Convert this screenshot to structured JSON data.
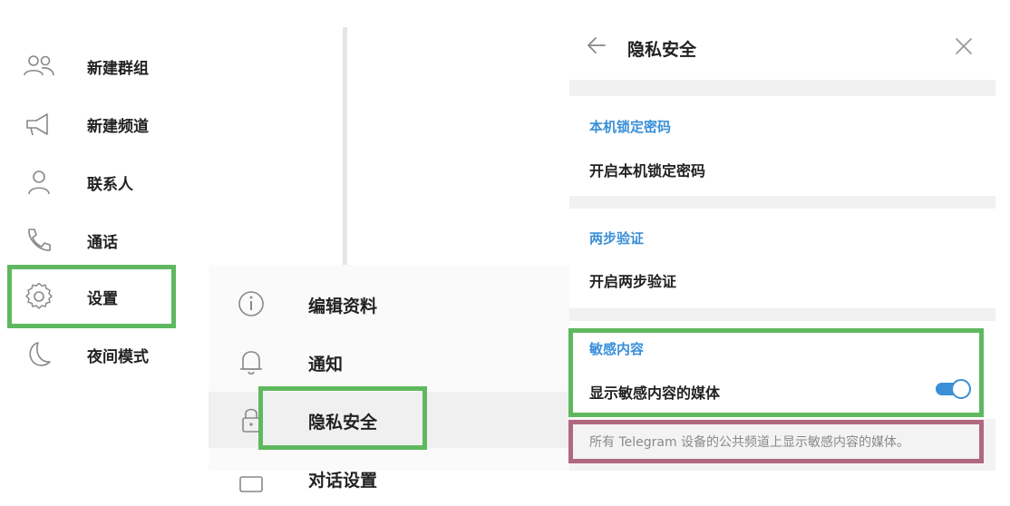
{
  "main_menu": [
    {
      "label": "新建群组",
      "icon": "group-icon"
    },
    {
      "label": "新建频道",
      "icon": "megaphone-icon"
    },
    {
      "label": "联系人",
      "icon": "person-icon"
    },
    {
      "label": "通话",
      "icon": "phone-icon"
    },
    {
      "label": "设置",
      "icon": "gear-icon"
    },
    {
      "label": "夜间模式",
      "icon": "moon-icon"
    }
  ],
  "settings_menu": [
    {
      "label": "编辑资料",
      "icon": "info-icon"
    },
    {
      "label": "通知",
      "icon": "bell-icon"
    },
    {
      "label": "隐私安全",
      "icon": "lock-icon"
    },
    {
      "label": "对话设置",
      "icon": "chat-icon"
    }
  ],
  "privacy_panel": {
    "title": "隐私安全",
    "passcode_section": {
      "title": "本机锁定密码",
      "row": "开启本机锁定密码"
    },
    "two_step_section": {
      "title": "两步验证",
      "row": "开启两步验证"
    },
    "sensitive_section": {
      "title": "敏感内容",
      "row": "显示敏感内容的媒体",
      "toggle_on": true
    },
    "hint": "所有 Telegram 设备的公共频道上显示敏感内容的媒体。"
  },
  "colors": {
    "accent": "#3a8fd8",
    "highlight_green": "#5fb85f",
    "highlight_pink": "#b1687f"
  }
}
